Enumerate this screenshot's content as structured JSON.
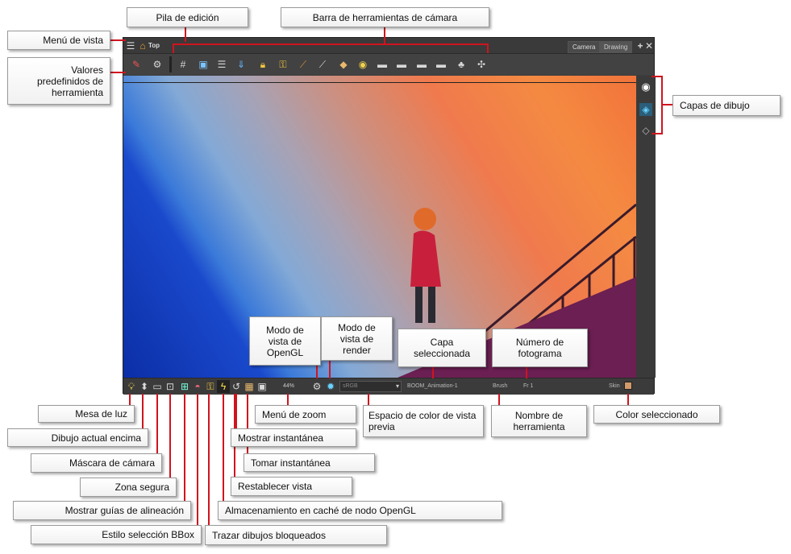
{
  "viewport": {
    "view_label": "Top",
    "tabs": [
      "Camera",
      "Drawing"
    ],
    "status": {
      "zoom": "44%",
      "color_space": "sRGB",
      "layer": "BOOM_Animation-1",
      "tool": "Brush",
      "frame": "Fr 1",
      "color_name": "Skin"
    },
    "colors": {
      "selected_swatch": "#d19a6a",
      "accent_line": "#d0141e"
    }
  },
  "callouts": {
    "edit_stack": "Pila de edición",
    "camera_toolbar": "Barra de herramientas de cámara",
    "view_menu": "Menú de vista",
    "tool_presets": "Valores predefinidos de herramienta",
    "drawing_layers": "Capas de dibujo",
    "opengl_view": "Modo de vista de OpenGL",
    "render_view": "Modo de vista de render",
    "selected_layer": "Capa seleccionada",
    "frame_number": "Número de fotograma",
    "light_table": "Mesa de luz",
    "current_drawing_top": "Dibujo actual encima",
    "camera_mask": "Máscara de cámara",
    "safe_area": "Zona segura",
    "show_guides": "Mostrar guías de alineación",
    "bbox_style": "Estilo selección BBox",
    "zoom_menu": "Menú de zoom",
    "show_snapshot": "Mostrar instantánea",
    "take_snapshot": "Tomar instantánea",
    "reset_view": "Restablecer vista",
    "opengl_cache": "Almacenamiento en caché de nodo OpenGL",
    "onion_locked": "Trazar dibujos bloqueados",
    "color_space": "Espacio de color de vista previa",
    "tool_name": "Nombre de herramienta",
    "selected_color": "Color seleccionado"
  }
}
